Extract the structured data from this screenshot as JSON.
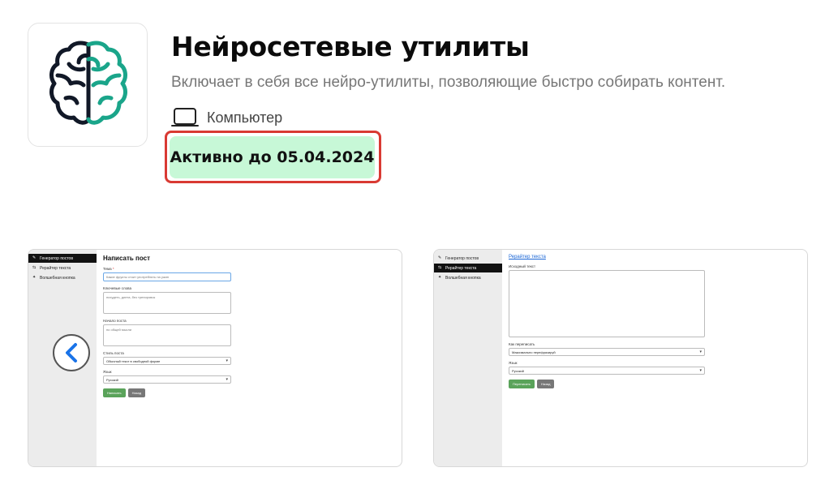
{
  "app": {
    "icon_name": "brain-icon",
    "title": "Нейросетевые утилиты",
    "description": "Включает в себя все нейро-утилиты, позволяющие быстро собирать контент.",
    "platform_icon": "laptop-icon",
    "platform_label": "Компьютер",
    "status_text": "Активно до 05.04.2024",
    "colors": {
      "brain_left": "#111827",
      "brain_right": "#1aa58a",
      "status_bg": "#c7f8d7",
      "highlight_border": "#d93a33"
    }
  },
  "screenshots": {
    "prev_icon": "chevron-left-icon",
    "first": {
      "sidebar": [
        {
          "icon": "edit-icon",
          "label": "Генератор постов"
        },
        {
          "icon": "rewrite-icon",
          "label": "Рерайтер текста"
        },
        {
          "icon": "magic-wand-icon",
          "label": "Волшебная кнопка"
        }
      ],
      "heading": "Написать пост",
      "topic_label": "Тема",
      "topic_value": "Какие фрукты стоит употреблять на ужин",
      "keywords_label": "Ключевые слова",
      "keywords_value": "похудеть, диета, без тренировок",
      "intro_label": "Начало поста",
      "intro_value": "по общей мысли",
      "style_label": "Стиль поста",
      "style_value": "Обычный текст в свободной форме",
      "lang_label": "Язык",
      "lang_value": "Русский",
      "write_button": "Написать",
      "back_button": "Назад"
    },
    "second": {
      "sidebar": [
        {
          "icon": "edit-icon",
          "label": "Генератор постов"
        },
        {
          "icon": "rewrite-icon",
          "label": "Рерайтер текста"
        },
        {
          "icon": "magic-wand-icon",
          "label": "Волшебная кнопка"
        }
      ],
      "heading_link": "Рерайтер текста",
      "source_label": "Исходный текст",
      "how_label": "Как переписать",
      "how_value": "Максимально перефразируй",
      "lang_label": "Язык",
      "lang_value": "Русский",
      "rewrite_button": "Переписать",
      "back_button": "Назад"
    }
  }
}
